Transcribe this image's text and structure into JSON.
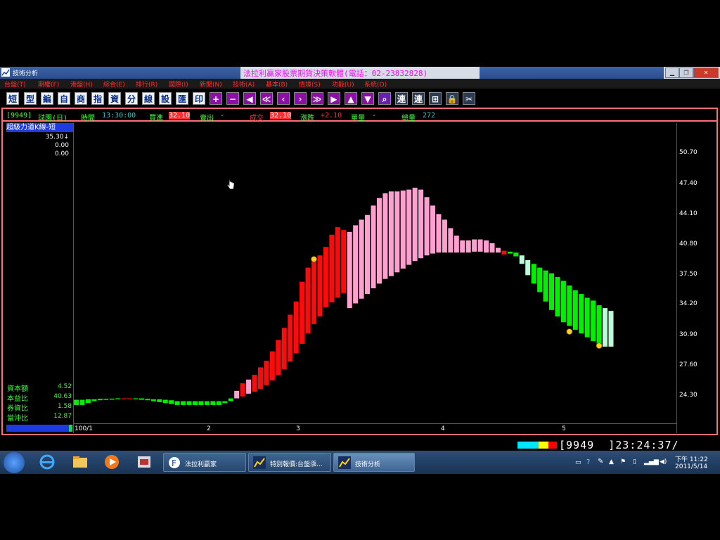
{
  "window": {
    "title": "技術分析",
    "center_title": "法拉利贏家股票期貨決策軟體(電話：02-23832828)"
  },
  "menu": [
    "台盤(T)",
    "期權(F)",
    "港盤(H)",
    "綜合(E)",
    "排行(R)",
    "國際(I)",
    "新聞(N)",
    "技術(A)",
    "基本(B)",
    "情境(S)",
    "功能(U)",
    "系統(O)"
  ],
  "toolbar": [
    "短",
    "型",
    "編",
    "自",
    "商",
    "指",
    "資",
    "分",
    "線",
    "設",
    "匯",
    "印",
    "+",
    "−",
    "◀",
    "≪",
    "‹",
    "›",
    "≫",
    "▶",
    "▲",
    "▼",
    "⌕",
    "連",
    "連",
    "⊞",
    "🔒",
    "✂"
  ],
  "info": {
    "code": "[9949]",
    "name": "琺園(日)",
    "time_label": "時間",
    "time_value": "13:30:00",
    "bid_label": "買進",
    "bid_value": "32.10",
    "ask_label": "賣出",
    "ask_value": "-",
    "deal_label": "成交",
    "deal_value": "32.10",
    "change_label": "漲跌",
    "change_value": "+2.10",
    "vol_label": "單量",
    "vol_value": "-",
    "total_label": "總量",
    "total_value": "272"
  },
  "indicator": {
    "title": "超級力道K線-短",
    "values": [
      "35.30↓",
      "0.00",
      "0.00"
    ]
  },
  "stats": [
    {
      "label": "資本額",
      "value": "4.52"
    },
    {
      "label": "本益比",
      "value": "40.63"
    },
    {
      "label": "券資比",
      "value": "1.58"
    },
    {
      "label": "當沖比",
      "value": "12.87"
    }
  ],
  "chart_data": {
    "type": "bar",
    "y_ticks": [
      "50.70",
      "47.40",
      "44.10",
      "40.80",
      "37.50",
      "34.20",
      "30.90",
      "27.60",
      "24.30"
    ],
    "x_ticks": [
      "100/1",
      "2",
      "3",
      "4",
      "5"
    ],
    "ylim": [
      22.6,
      54.0
    ],
    "candles": [
      {
        "o": 24.4,
        "c": 24.95,
        "k": "g"
      },
      {
        "o": 24.4,
        "c": 24.95,
        "k": "g"
      },
      {
        "o": 24.6,
        "c": 25.0,
        "k": "g"
      },
      {
        "o": 24.8,
        "c": 25.0,
        "k": "g"
      },
      {
        "o": 24.9,
        "c": 25.05,
        "k": "g"
      },
      {
        "o": 24.95,
        "c": 25.05,
        "k": "g"
      },
      {
        "o": 25.0,
        "c": 25.07,
        "k": "g"
      },
      {
        "o": 25.0,
        "c": 25.1,
        "k": "g"
      },
      {
        "o": 25.0,
        "c": 25.1,
        "k": "r"
      },
      {
        "o": 25.0,
        "c": 25.1,
        "k": "r"
      },
      {
        "o": 25.0,
        "c": 25.1,
        "k": "g"
      },
      {
        "o": 24.95,
        "c": 25.1,
        "k": "g"
      },
      {
        "o": 24.9,
        "c": 25.05,
        "k": "g"
      },
      {
        "o": 24.8,
        "c": 25.0,
        "k": "g"
      },
      {
        "o": 24.7,
        "c": 25.0,
        "k": "g"
      },
      {
        "o": 24.6,
        "c": 24.95,
        "k": "g"
      },
      {
        "o": 24.5,
        "c": 24.9,
        "k": "g"
      },
      {
        "o": 24.4,
        "c": 24.8,
        "k": "g"
      },
      {
        "o": 24.4,
        "c": 24.8,
        "k": "g"
      },
      {
        "o": 24.4,
        "c": 24.8,
        "k": "g"
      },
      {
        "o": 24.4,
        "c": 24.8,
        "k": "g"
      },
      {
        "o": 24.4,
        "c": 24.8,
        "k": "g"
      },
      {
        "o": 24.4,
        "c": 24.8,
        "k": "g"
      },
      {
        "o": 24.4,
        "c": 24.8,
        "k": "g"
      },
      {
        "o": 24.4,
        "c": 24.8,
        "k": "g"
      },
      {
        "o": 24.6,
        "c": 24.8,
        "k": "g"
      },
      {
        "o": 24.8,
        "c": 25.1,
        "k": "g"
      },
      {
        "o": 25.1,
        "c": 25.9,
        "k": "p"
      },
      {
        "o": 25.3,
        "c": 26.7,
        "k": "r"
      },
      {
        "o": 25.6,
        "c": 27.1,
        "k": "p"
      },
      {
        "o": 25.8,
        "c": 27.6,
        "k": "r"
      },
      {
        "o": 26.1,
        "c": 28.4,
        "k": "r"
      },
      {
        "o": 26.5,
        "c": 29.1,
        "k": "r"
      },
      {
        "o": 27.0,
        "c": 30.1,
        "k": "r"
      },
      {
        "o": 27.6,
        "c": 31.3,
        "k": "r"
      },
      {
        "o": 28.2,
        "c": 32.6,
        "k": "r"
      },
      {
        "o": 29.0,
        "c": 34.0,
        "k": "r"
      },
      {
        "o": 29.9,
        "c": 35.4,
        "k": "r"
      },
      {
        "o": 30.9,
        "c": 37.5,
        "k": "r"
      },
      {
        "o": 32.0,
        "c": 39.0,
        "k": "r"
      },
      {
        "o": 33.0,
        "c": 39.7,
        "k": "r"
      },
      {
        "o": 33.8,
        "c": 40.3,
        "k": "r"
      },
      {
        "o": 34.8,
        "c": 41.2,
        "k": "r"
      },
      {
        "o": 35.3,
        "c": 42.5,
        "k": "r"
      },
      {
        "o": 35.8,
        "c": 43.3,
        "k": "r"
      },
      {
        "o": 36.3,
        "c": 43.0,
        "k": "r"
      },
      {
        "o": 34.7,
        "c": 42.8,
        "k": "p"
      },
      {
        "o": 35.2,
        "c": 43.5,
        "k": "p"
      },
      {
        "o": 35.7,
        "c": 44.1,
        "k": "p"
      },
      {
        "o": 36.2,
        "c": 44.6,
        "k": "p"
      },
      {
        "o": 36.8,
        "c": 45.6,
        "k": "p"
      },
      {
        "o": 37.3,
        "c": 46.4,
        "k": "p"
      },
      {
        "o": 37.8,
        "c": 46.9,
        "k": "p"
      },
      {
        "o": 38.1,
        "c": 47.1,
        "k": "p"
      },
      {
        "o": 38.5,
        "c": 47.1,
        "k": "p"
      },
      {
        "o": 38.9,
        "c": 47.2,
        "k": "p"
      },
      {
        "o": 39.3,
        "c": 47.3,
        "k": "p"
      },
      {
        "o": 39.7,
        "c": 47.5,
        "k": "p"
      },
      {
        "o": 40.0,
        "c": 47.3,
        "k": "p"
      },
      {
        "o": 40.3,
        "c": 46.5,
        "k": "p"
      },
      {
        "o": 40.5,
        "c": 45.6,
        "k": "p"
      },
      {
        "o": 40.6,
        "c": 44.7,
        "k": "p"
      },
      {
        "o": 40.6,
        "c": 44.1,
        "k": "p"
      },
      {
        "o": 40.6,
        "c": 43.2,
        "k": "p"
      },
      {
        "o": 40.6,
        "c": 42.4,
        "k": "p"
      },
      {
        "o": 40.6,
        "c": 41.9,
        "k": "p"
      },
      {
        "o": 40.6,
        "c": 41.9,
        "k": "p"
      },
      {
        "o": 40.7,
        "c": 42.0,
        "k": "p"
      },
      {
        "o": 40.7,
        "c": 42.0,
        "k": "p"
      },
      {
        "o": 40.6,
        "c": 41.9,
        "k": "p"
      },
      {
        "o": 40.6,
        "c": 41.6,
        "k": "p"
      },
      {
        "o": 40.6,
        "c": 41.1,
        "k": "p"
      },
      {
        "o": 40.4,
        "c": 40.8,
        "k": "r"
      },
      {
        "o": 40.5,
        "c": 40.7,
        "k": "g"
      },
      {
        "o": 40.2,
        "c": 40.6,
        "k": "g"
      },
      {
        "o": 39.4,
        "c": 40.3,
        "k": "l"
      },
      {
        "o": 38.2,
        "c": 39.8,
        "k": "l"
      },
      {
        "o": 37.3,
        "c": 39.4,
        "k": "g"
      },
      {
        "o": 36.4,
        "c": 39.0,
        "k": "g"
      },
      {
        "o": 35.4,
        "c": 38.7,
        "k": "g"
      },
      {
        "o": 34.5,
        "c": 38.4,
        "k": "g"
      },
      {
        "o": 33.8,
        "c": 38.0,
        "k": "g"
      },
      {
        "o": 33.2,
        "c": 37.6,
        "k": "g"
      },
      {
        "o": 32.8,
        "c": 37.1,
        "k": "g"
      },
      {
        "o": 32.4,
        "c": 36.6,
        "k": "g"
      },
      {
        "o": 32.0,
        "c": 36.2,
        "k": "g"
      },
      {
        "o": 31.6,
        "c": 35.8,
        "k": "g"
      },
      {
        "o": 31.2,
        "c": 35.5,
        "k": "g"
      },
      {
        "o": 30.8,
        "c": 35.0,
        "k": "g"
      },
      {
        "o": 30.6,
        "c": 34.7,
        "k": "l"
      },
      {
        "o": 30.6,
        "c": 34.4,
        "k": "l"
      }
    ],
    "markers": [
      {
        "index": 40,
        "value": 39.9
      },
      {
        "index": 83,
        "value": 32.2
      },
      {
        "index": 88,
        "value": 30.7
      }
    ]
  },
  "status": {
    "code": "[9949_  ]23:24:37/",
    "colors": [
      "#00e5ff",
      "#ffff00",
      "#ff0000"
    ]
  },
  "taskbar": {
    "buttons": [
      "法拉利贏家",
      "特別報價:台盤漲...",
      "技術分析"
    ],
    "time": "下午 11:22",
    "date": "2011/5/14"
  }
}
